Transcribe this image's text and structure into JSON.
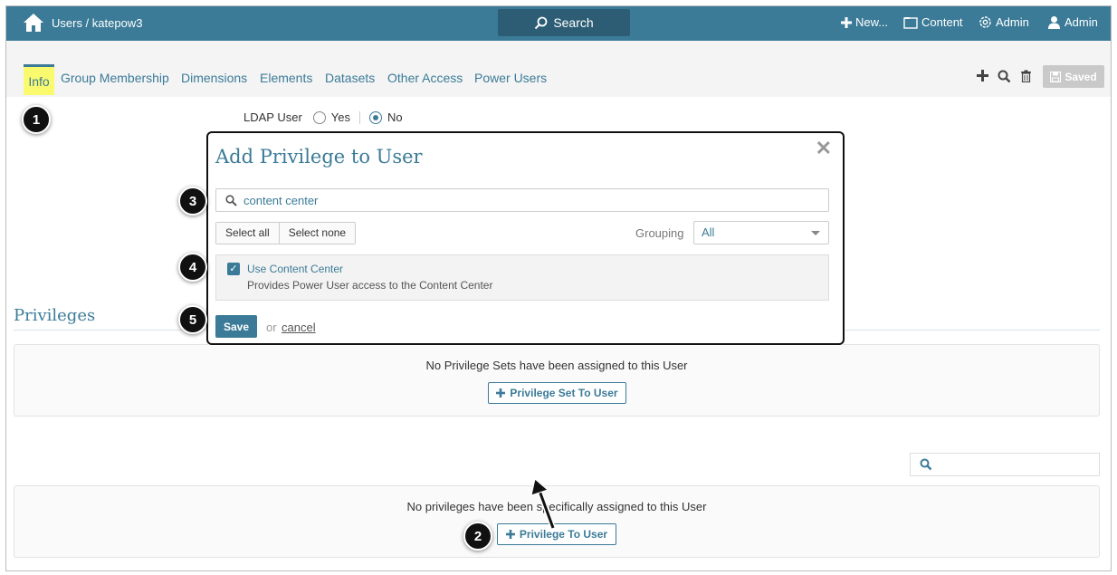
{
  "topbar": {
    "breadcrumb": "Users / katepow3",
    "search_label": "Search",
    "new_label": "New...",
    "content_label": "Content",
    "admin_label": "Admin",
    "user_label": "Admin",
    "bar_color": "#3b7b98"
  },
  "tabs": [
    {
      "label": "Info",
      "active": true
    },
    {
      "label": "Group Membership"
    },
    {
      "label": "Dimensions"
    },
    {
      "label": "Elements"
    },
    {
      "label": "Datasets"
    },
    {
      "label": "Other Access"
    },
    {
      "label": "Power Users"
    }
  ],
  "toolbar": {
    "saved_label": "Saved"
  },
  "ldap": {
    "label": "LDAP User",
    "options": [
      "Yes",
      "No"
    ],
    "selected": "No"
  },
  "modal": {
    "title": "Add Privilege to User",
    "search_value": "content center",
    "select_all": "Select all",
    "select_none": "Select none",
    "grouping_label": "Grouping",
    "grouping_value": "All",
    "item": {
      "name": "Use Content Center",
      "description": "Provides Power User access to the Content Center",
      "checked": true
    },
    "save_label": "Save",
    "or_label": "or",
    "cancel_label": "cancel"
  },
  "privileges": {
    "title": "Privileges",
    "sets_message": "No Privilege Sets have been assigned to this User",
    "sets_button": "Privilege Set To User",
    "priv_message": "No privileges have been specifically assigned to this User",
    "priv_button": "Privilege To User"
  },
  "steps": [
    "1",
    "2",
    "3",
    "4",
    "5"
  ]
}
